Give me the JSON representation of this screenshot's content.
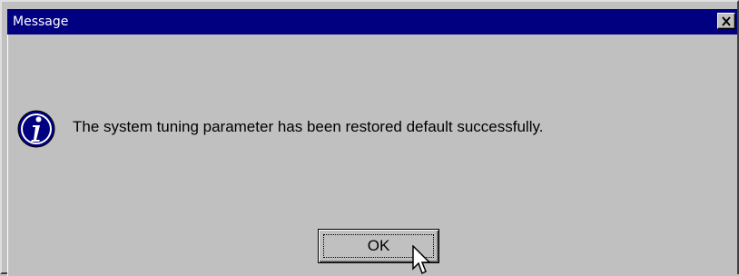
{
  "window": {
    "title": "Message",
    "close_icon": "close-x-icon"
  },
  "message": {
    "icon": "info-icon",
    "text": "The system tuning parameter has been restored default successfully."
  },
  "buttons": {
    "ok_label": "OK"
  },
  "colors": {
    "titlebar": "#000080",
    "dialog_bg": "#c0c0c0",
    "icon_blue": "#000080"
  }
}
